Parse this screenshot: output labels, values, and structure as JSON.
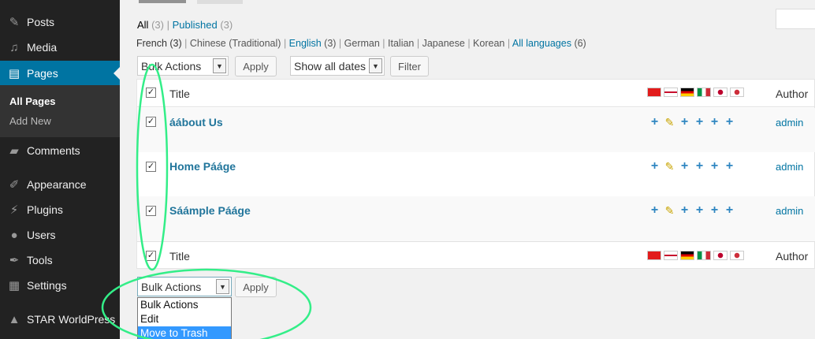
{
  "sidebar": {
    "items": [
      {
        "label": "Posts",
        "icon": "pin-icon"
      },
      {
        "label": "Media",
        "icon": "media-icon"
      },
      {
        "label": "Pages",
        "icon": "pages-icon"
      },
      {
        "label": "Comments",
        "icon": "comments-icon"
      },
      {
        "label": "Appearance",
        "icon": "brush-icon"
      },
      {
        "label": "Plugins",
        "icon": "plug-icon"
      },
      {
        "label": "Users",
        "icon": "user-icon"
      },
      {
        "label": "Tools",
        "icon": "wrench-icon"
      },
      {
        "label": "Settings",
        "icon": "settings-icon"
      },
      {
        "label": "STAR WorldPress",
        "icon": "star-icon"
      }
    ],
    "submenu": [
      "All Pages",
      "Add New"
    ]
  },
  "views": {
    "all": "All",
    "all_count": "(3)",
    "published": "Published",
    "published_count": "(3)"
  },
  "languages": {
    "french": "French",
    "french_count": "(3)",
    "chinese": "Chinese (Traditional)",
    "english": "English",
    "english_count": "(3)",
    "german": "German",
    "italian": "Italian",
    "japanese": "Japanese",
    "korean": "Korean",
    "all": "All languages",
    "all_count": "(6)"
  },
  "toolbar": {
    "bulk_actions": "Bulk Actions",
    "apply": "Apply",
    "dates": "Show all dates",
    "filter": "Filter"
  },
  "table": {
    "col_title": "Title",
    "col_author": "Author",
    "rows": [
      {
        "title": "áábout Us",
        "author": "admin"
      },
      {
        "title": "Home Pááge",
        "author": "admin"
      },
      {
        "title": "Sáámple Pááge",
        "author": "admin"
      }
    ]
  },
  "dropdown": {
    "options": [
      "Bulk Actions",
      "Edit",
      "Move to Trash"
    ],
    "selected": "Move to Trash"
  },
  "colors": {
    "sidebar_bg": "#222222",
    "active_menu": "#0074a2",
    "link": "#0074a2",
    "annotation": "#33ee88",
    "dropdown_selected": "#3399ff"
  }
}
